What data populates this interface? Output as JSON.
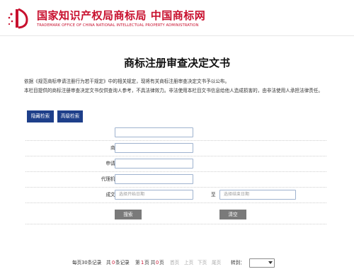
{
  "header": {
    "title": "国家知识产权局商标局 中国商标网",
    "subtitle": "TRADEMARK OFFICE OF CHINA NATIONAL INTELLECTUAL PROPERTY ADMINISTRATION",
    "logo_icon": "cnipa-emblem-icon",
    "brand_color": "#c8102e"
  },
  "page": {
    "title": "商标注册审查决定文书",
    "notice1": "依据《规范商标申请注册行为若干规定》中的相关规定，现将有关商标注册审查决定文书予以公布。",
    "notice2": "本栏目提供的商标注册审查决定文书仅供查询人参考，不具法律效力。非法使用本栏目文书信息给他人造成损害的，由非法使用人承担法律责任。"
  },
  "toggles": {
    "hide_search": "隐藏检索",
    "advanced_search": "高级检索",
    "accent": "#1e3f8a"
  },
  "form": {
    "app_no_label": "申请号：",
    "tm_name_label": "商标名称：",
    "applicant_label": "申请人名称：",
    "agency_label": "代理机构名称：",
    "date_label": "成文时间从：",
    "to_label": "至",
    "start_placeholder": "选择开始日期",
    "end_placeholder": "选择结束日期"
  },
  "actions": {
    "search": "搜索",
    "clear": "清空"
  },
  "pager": {
    "per_page": "每页30条记录",
    "total_prefix": "共",
    "total_count": "0",
    "total_suffix": "条记录",
    "page_prefix": "第",
    "page_current": "1",
    "page_middle": "页 共",
    "page_total": "0",
    "page_suffix": "页",
    "first": "首页",
    "prev": "上页",
    "next": "下页",
    "last": "尾页",
    "goto": "转到："
  }
}
